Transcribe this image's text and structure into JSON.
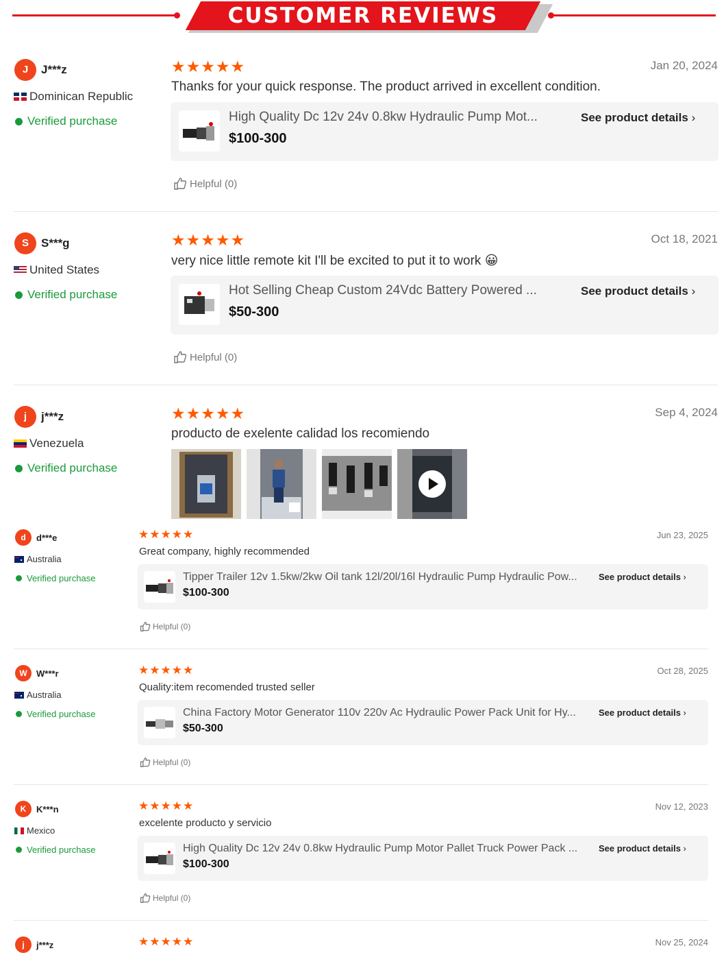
{
  "header": {
    "title": "CUSTOMER REVIEWS"
  },
  "colors": {
    "brand_red": "#e3141b",
    "star_orange": "#ff5a00",
    "verified_green": "#1a9a3a",
    "avatar_orange": "#f0441c"
  },
  "reviews": [
    {
      "initial": "J",
      "user": "J***z",
      "country": "Dominican Republic",
      "verified": "Verified purchase",
      "stars": "★★★★★",
      "date": "Jan 20, 2024",
      "text": "Thanks for your quick response. The product arrived in excellent condition.",
      "product": {
        "name": "High Quality Dc 12v 24v 0.8kw Hydraulic Pump Mot...",
        "price": "$100-300",
        "details": "See product details"
      },
      "helpful": "Helpful (0)"
    },
    {
      "initial": "S",
      "user": "S***g",
      "country": "United States",
      "verified": "Verified purchase",
      "stars": "★★★★★",
      "date": "Oct 18, 2021",
      "text": "very nice little remote kit I'll be excited to put it to work 😀",
      "product": {
        "name": "Hot Selling Cheap Custom 24Vdc Battery Powered ...",
        "price": "$50-300",
        "details": "See product details"
      },
      "helpful": "Helpful (0)"
    },
    {
      "initial": "j",
      "user": "j***z",
      "country": "Venezuela",
      "verified": "Verified purchase",
      "stars": "★★★★★",
      "date": "Sep 4, 2024",
      "text": "producto de exelente calidad los recomiendo",
      "media": [
        "photo-box",
        "photo-person",
        "photo-pumps",
        "video"
      ]
    },
    {
      "initial": "d",
      "user": "d***e",
      "country": "Australia",
      "verified": "Verified purchase",
      "stars": "★★★★★",
      "date": "Jun 23, 2025",
      "text": "Great company, highly recommended",
      "product": {
        "name": "Tipper Trailer 12v 1.5kw/2kw Oil tank 12l/20l/16l Hydraulic Pump Hydraulic Pow...",
        "price": "$100-300",
        "details": "See product details"
      },
      "helpful": "Helpful (0)"
    },
    {
      "initial": "W",
      "user": "W***r",
      "country": "Australia",
      "verified": "Verified purchase",
      "stars": "★★★★★",
      "date": "Oct 28, 2025",
      "text": "Quality:item recomended trusted seller",
      "product": {
        "name": "China Factory Motor Generator 110v 220v Ac Hydraulic Power Pack Unit for Hy...",
        "price": "$50-300",
        "details": "See product details"
      },
      "helpful": "Helpful (0)"
    },
    {
      "initial": "K",
      "user": "K***n",
      "country": "Mexico",
      "verified": "Verified purchase",
      "stars": "★★★★★",
      "date": "Nov 12, 2023",
      "text": "excelente producto y servicio",
      "product": {
        "name": "High Quality Dc 12v 24v 0.8kw Hydraulic Pump Motor Pallet Truck Power Pack ...",
        "price": "$100-300",
        "details": "See product details"
      },
      "helpful": "Helpful (0)"
    },
    {
      "initial": "j",
      "user": "j***z",
      "stars": "★★★★★",
      "date": "Nov 25, 2024"
    }
  ]
}
